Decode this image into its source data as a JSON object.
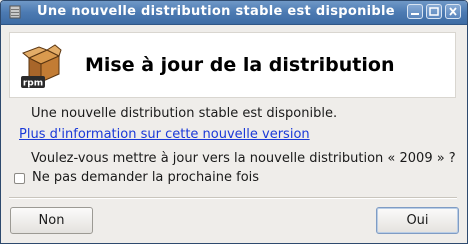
{
  "window": {
    "title": "Une nouvelle distribution stable est disponible",
    "controls": [
      "minimize-icon",
      "maximize-icon",
      "close-icon"
    ]
  },
  "header": {
    "icon": "rpm-package-icon",
    "icon_text": "rpm",
    "title": "Mise à jour de la distribution"
  },
  "body": {
    "message": "Une nouvelle distribution stable est disponible.",
    "link_text": "Plus d'information sur cette nouvelle version",
    "question": "Voulez-vous mettre à jour vers la nouvelle distribution « 2009 » ?",
    "checkbox_label": "Ne pas demander la prochaine fois",
    "checkbox_checked": false
  },
  "buttons": {
    "no_label": "Non",
    "yes_label": "Oui"
  },
  "colors": {
    "titlebar": "#4c7ab2",
    "link": "#1a39d8"
  }
}
